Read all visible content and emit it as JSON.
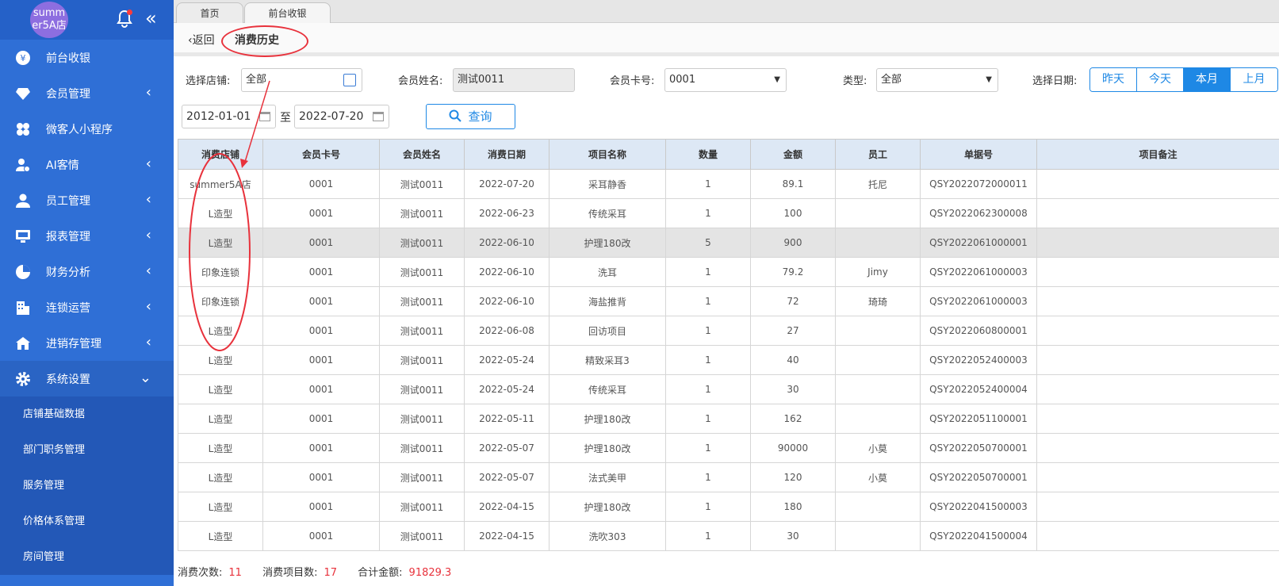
{
  "sidebar": {
    "avatar_text": "summer5A店",
    "menu": [
      {
        "label": "前台收银",
        "icon": "yen-icon",
        "has_submenu": false
      },
      {
        "label": "会员管理",
        "icon": "diamond-icon",
        "has_submenu": true
      },
      {
        "label": "微客人小程序",
        "icon": "flower-icon",
        "has_submenu": false
      },
      {
        "label": "AI客情",
        "icon": "user-heart-icon",
        "has_submenu": true
      },
      {
        "label": "员工管理",
        "icon": "user-icon",
        "has_submenu": true
      },
      {
        "label": "报表管理",
        "icon": "monitor-icon",
        "has_submenu": true
      },
      {
        "label": "财务分析",
        "icon": "pie-chart-icon",
        "has_submenu": true
      },
      {
        "label": "连锁运营",
        "icon": "building-icon",
        "has_submenu": true
      },
      {
        "label": "进销存管理",
        "icon": "house-icon",
        "has_submenu": true
      },
      {
        "label": "系统设置",
        "icon": "gear-icon",
        "has_submenu": true,
        "expanded": true
      }
    ],
    "submenu": [
      "店铺基础数据",
      "部门职务管理",
      "服务管理",
      "价格体系管理",
      "房间管理"
    ]
  },
  "tabs": [
    "首页",
    "前台收银"
  ],
  "header": {
    "back": "返回",
    "title": "消费历史"
  },
  "filters": {
    "shop_label": "选择店铺:",
    "shop_value": "全部",
    "member_name_label": "会员姓名:",
    "member_name_value": "测试0011",
    "card_label": "会员卡号:",
    "card_value": "0001",
    "type_label": "类型:",
    "type_value": "全部",
    "date_label": "选择日期:",
    "date_buttons": [
      "昨天",
      "今天",
      "本月",
      "上月"
    ],
    "active_date_button": "本月",
    "start_date": "2012-01-01",
    "to": "至",
    "end_date": "2022-07-20",
    "query_label": "查询"
  },
  "table": {
    "columns": [
      "消费店铺",
      "会员卡号",
      "会员姓名",
      "消费日期",
      "项目名称",
      "数量",
      "金额",
      "员工",
      "单据号",
      "项目备注"
    ],
    "rows": [
      [
        "summer5A店",
        "0001",
        "测试0011",
        "2022-07-20",
        "采耳静香",
        "1",
        "89.1",
        "托尼",
        "QSY2022072000011",
        ""
      ],
      [
        "L造型",
        "0001",
        "测试0011",
        "2022-06-23",
        "传统采耳",
        "1",
        "100",
        "",
        "QSY2022062300008",
        ""
      ],
      [
        "L造型",
        "0001",
        "测试0011",
        "2022-06-10",
        "护理180改",
        "5",
        "900",
        "",
        "QSY2022061000001",
        ""
      ],
      [
        "印象连锁",
        "0001",
        "测试0011",
        "2022-06-10",
        "洗耳",
        "1",
        "79.2",
        "Jimy",
        "QSY2022061000003",
        ""
      ],
      [
        "印象连锁",
        "0001",
        "测试0011",
        "2022-06-10",
        "海盐推背",
        "1",
        "72",
        "琦琦",
        "QSY2022061000003",
        ""
      ],
      [
        "L造型",
        "0001",
        "测试0011",
        "2022-06-08",
        "回访项目",
        "1",
        "27",
        "",
        "QSY2022060800001",
        ""
      ],
      [
        "L造型",
        "0001",
        "测试0011",
        "2022-05-24",
        "精致采耳3",
        "1",
        "40",
        "",
        "QSY2022052400003",
        ""
      ],
      [
        "L造型",
        "0001",
        "测试0011",
        "2022-05-24",
        "传统采耳",
        "1",
        "30",
        "",
        "QSY2022052400004",
        ""
      ],
      [
        "L造型",
        "0001",
        "测试0011",
        "2022-05-11",
        "护理180改",
        "1",
        "162",
        "",
        "QSY2022051100001",
        ""
      ],
      [
        "L造型",
        "0001",
        "测试0011",
        "2022-05-07",
        "护理180改",
        "1",
        "90000",
        "小莫",
        "QSY2022050700001",
        ""
      ],
      [
        "L造型",
        "0001",
        "测试0011",
        "2022-05-07",
        "法式美甲",
        "1",
        "120",
        "小莫",
        "QSY2022050700001",
        ""
      ],
      [
        "L造型",
        "0001",
        "测试0011",
        "2022-04-15",
        "护理180改",
        "1",
        "180",
        "",
        "QSY2022041500003",
        ""
      ],
      [
        "L造型",
        "0001",
        "测试0011",
        "2022-04-15",
        "洗吹303",
        "1",
        "30",
        "",
        "QSY2022041500004",
        ""
      ]
    ],
    "highlighted_row": 2
  },
  "footer": {
    "count_label": "消费次数:",
    "count_value": "11",
    "items_label": "消费项目数:",
    "items_value": "17",
    "total_label": "合计金额:",
    "total_value": "91829.3"
  },
  "colors": {
    "sidebar": "#2f6fd6",
    "accent": "#1e88e5",
    "annotation": "#e8323c",
    "total": "#e8323c"
  }
}
